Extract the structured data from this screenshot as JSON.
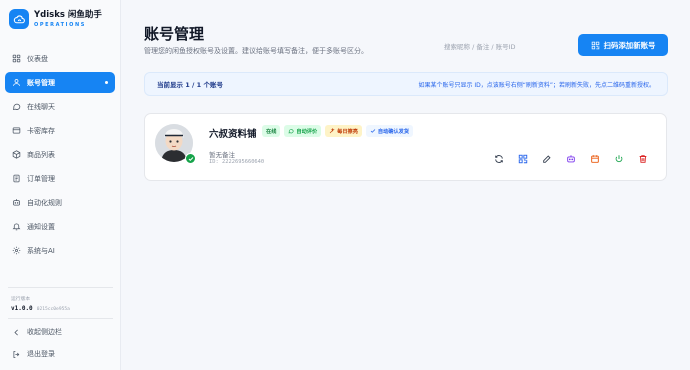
{
  "brand": {
    "name": "Ydisks 闲鱼助手",
    "subtitle": "OPERATIONS"
  },
  "sidebar": {
    "items": [
      {
        "label": "仪表盘",
        "icon": "dashboard-icon",
        "active": false
      },
      {
        "label": "账号管理",
        "icon": "user-icon",
        "active": true
      },
      {
        "label": "在线聊天",
        "icon": "chat-icon",
        "active": false
      },
      {
        "label": "卡密库存",
        "icon": "card-icon",
        "active": false
      },
      {
        "label": "商品列表",
        "icon": "box-icon",
        "active": false
      },
      {
        "label": "订单管理",
        "icon": "order-icon",
        "active": false
      },
      {
        "label": "自动化规则",
        "icon": "robot-icon",
        "active": false
      },
      {
        "label": "通知设置",
        "icon": "bell-icon",
        "active": false
      },
      {
        "label": "系统与AI",
        "icon": "gear-icon",
        "active": false
      }
    ],
    "version_label": "运行版本",
    "version": "v1.0.0",
    "version_hash": "0215cc0e955a",
    "collapse_label": "收起侧边栏",
    "logout_label": "退出登录"
  },
  "header": {
    "title": "账号管理",
    "description": "管理您的闲鱼授权账号及设置。建议给账号填写备注，便于多账号区分。",
    "search_placeholder": "搜索昵称 / 备注 / 账号ID",
    "scan_button": "扫码添加新账号"
  },
  "info_bar": {
    "left": "当前显示 1 / 1 个账号",
    "right": "如果某个账号只显示 ID，点该账号右侧“刷新资料”；若刷新失败，先点二维码重新授权。"
  },
  "account": {
    "name": "六叔资料铺",
    "tags": [
      "在线",
      "自动评价",
      "每日擦亮",
      "自动确认发货"
    ],
    "note": "暂无备注",
    "id_text": "ID: 2222695660640"
  },
  "actions": [
    {
      "name": "refresh-icon",
      "color": "#374151"
    },
    {
      "name": "qrcode-icon",
      "color": "#2563eb"
    },
    {
      "name": "edit-icon",
      "color": "#374151"
    },
    {
      "name": "robot-icon",
      "color": "#7c3aed"
    },
    {
      "name": "calendar-icon",
      "color": "#ea580c"
    },
    {
      "name": "power-icon",
      "color": "#16a34a"
    },
    {
      "name": "trash-icon",
      "color": "#dc2626"
    }
  ],
  "colors": {
    "accent": "#1684f3",
    "online": "#16a34a",
    "danger": "#dc2626"
  }
}
